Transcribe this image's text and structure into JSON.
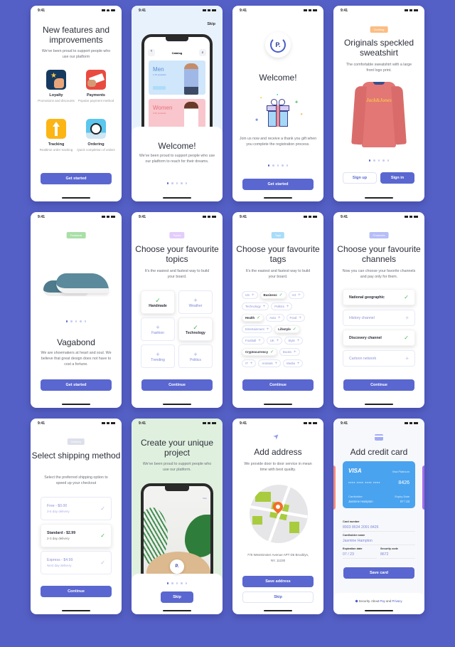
{
  "status_time": "9:41",
  "colors": {
    "background": "#5560c6",
    "accent": "#5a67d0",
    "check": "#3fb950"
  },
  "s1": {
    "title": "New features and improvements",
    "subtitle": "We've been proud to support people who use our platform",
    "features": [
      {
        "label": "Loyalty",
        "desc": "Promotions and discounts",
        "icon": "star-hand-icon"
      },
      {
        "label": "Payments",
        "desc": "Popular payment method",
        "icon": "card-hand-icon"
      },
      {
        "label": "Tracking",
        "desc": "Realtime order tracking",
        "icon": "arrow-up-icon"
      },
      {
        "label": "Ordering",
        "desc": "Quick completion of orders",
        "icon": "alarm-clock-icon"
      }
    ],
    "button": "Get started"
  },
  "s2": {
    "skip": "Skip",
    "inner_title": "Catalog",
    "men": "Men",
    "men_count": "1.7K products",
    "women": "Women",
    "women_count": "3.4K products",
    "title": "Welcome!",
    "subtitle": "We've been proud to support people who use our platform to reach for their dreams."
  },
  "s3": {
    "logo": "P.",
    "title": "Welcome!",
    "subtitle": "Join us now and receive a thank you gift when you complete the registration process.",
    "button": "Get started"
  },
  "s4": {
    "badge": "Clothing",
    "title": "Originals speckled sweatshirt",
    "subtitle": "The comfortable sweatshirt with a large front logo print.",
    "print": "Jack&Jones",
    "signup": "Sign up",
    "signin": "Sign in"
  },
  "s5": {
    "badge": "Footwear",
    "title": "Vagabond",
    "subtitle": "We are shoemakers at heart and soul. We believe that great design does not have to cost a fortune.",
    "button": "Get started"
  },
  "s6": {
    "badge": "Topics",
    "title": "Choose your favourite topics",
    "subtitle": "It's the easiest and fastest way to build your board.",
    "topics": [
      {
        "label": "Handmade",
        "selected": true
      },
      {
        "label": "Weather",
        "selected": false
      },
      {
        "label": "Fashion",
        "selected": false
      },
      {
        "label": "Technology",
        "selected": true
      },
      {
        "label": "Trending",
        "selected": false
      },
      {
        "label": "Politics",
        "selected": false
      }
    ],
    "button": "Continue"
  },
  "s7": {
    "badge": "Tags",
    "title": "Choose your favourite tags",
    "subtitle": "It's the easiest and fastest way to build your board.",
    "tag_rows": [
      [
        {
          "label": "US",
          "selected": false
        },
        {
          "label": "Business",
          "selected": true
        },
        {
          "label": "Art",
          "selected": false
        }
      ],
      [
        {
          "label": "Technology",
          "selected": false
        },
        {
          "label": "Politics",
          "selected": false
        }
      ],
      [
        {
          "label": "Health",
          "selected": true
        },
        {
          "label": "Auto",
          "selected": false
        },
        {
          "label": "Food",
          "selected": false
        }
      ],
      [
        {
          "label": "Entertainment",
          "selected": false
        },
        {
          "label": "Lifestyle",
          "selected": true
        }
      ],
      [
        {
          "label": "Football",
          "selected": false
        },
        {
          "label": "UK",
          "selected": false
        },
        {
          "label": "Style",
          "selected": false
        }
      ],
      [
        {
          "label": "Cryptocurrency",
          "selected": true
        },
        {
          "label": "Books",
          "selected": false
        }
      ],
      [
        {
          "label": "IT",
          "selected": false
        },
        {
          "label": "Animals",
          "selected": false
        },
        {
          "label": "Media",
          "selected": false
        }
      ]
    ],
    "button": "Continue"
  },
  "s8": {
    "badge": "Channels",
    "title": "Choose your favourite channels",
    "subtitle": "Now you can choose your favorite channels and pay only for them.",
    "channels": [
      {
        "label": "National geographic",
        "selected": true
      },
      {
        "label": "History channel",
        "selected": false
      },
      {
        "label": "Discovery channel",
        "selected": true
      },
      {
        "label": "Cartoon network",
        "selected": false
      }
    ],
    "button": "Continue"
  },
  "s9": {
    "badge": "Delivery",
    "title": "Select shipping method",
    "subtitle": "Select the preferred shipping option to speed up your checkout",
    "options": [
      {
        "label": "Free - $0.00",
        "desc": "3-5 day delivery",
        "selected": false
      },
      {
        "label": "Standard - $2.99",
        "desc": "2-3 day delivery",
        "selected": true
      },
      {
        "label": "Express - $4.99",
        "desc": "Next day delivery",
        "selected": false
      }
    ],
    "button": "Continue"
  },
  "s10": {
    "title": "Create your unique project",
    "subtitle": "We've been proud to support people who use our platform.",
    "inner_skip": "Skip",
    "button": "Skip"
  },
  "s11": {
    "title": "Add address",
    "subtitle": "We provide door to door service in mean time with best quality.",
    "address": "775 Westminster Avenue APT D5 Brooklyn, NY, 11230",
    "save": "Save address",
    "skip": "Skip"
  },
  "s12": {
    "title": "Add credit card",
    "card": {
      "brand": "VISA",
      "tier": "Visa Platinum",
      "masked": "**** **** **** ****",
      "last4": "8426",
      "holder_label": "Cardholder",
      "holder": "Jasmine Hampton",
      "expiry_label": "Expiry Date",
      "expiry": "07 / 23"
    },
    "fields": {
      "number_label": "Card number",
      "number": "8903  8634  2091  8426",
      "name_label": "Cardholder name",
      "name": "Jasmine Hampton",
      "exp_label": "Expiration date",
      "exp": "07 / 23",
      "cvv_label": "Security code",
      "cvv": "8672"
    },
    "button": "Save card",
    "footer_prefix": "Security. About ",
    "footer_pay": "Pay",
    "footer_and": " and ",
    "footer_privacy": "Privacy."
  }
}
